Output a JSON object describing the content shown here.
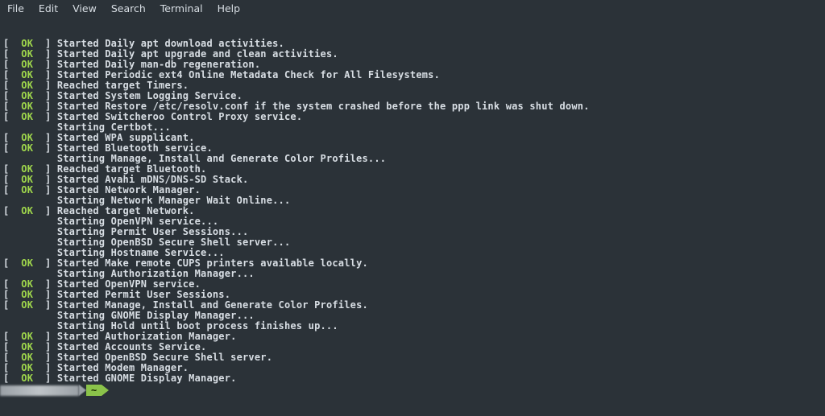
{
  "menu": [
    "File",
    "Edit",
    "View",
    "Search",
    "Terminal",
    "Help"
  ],
  "ok": "OK",
  "lines": [
    {
      "s": "ok",
      "t": "Started Daily apt download activities."
    },
    {
      "s": "ok",
      "t": "Started Daily apt upgrade and clean activities."
    },
    {
      "s": "ok",
      "t": "Started Daily man-db regeneration."
    },
    {
      "s": "ok",
      "t": "Started Periodic ext4 Online Metadata Check for All Filesystems."
    },
    {
      "s": "ok",
      "t": "Reached target Timers."
    },
    {
      "s": "ok",
      "t": "Started System Logging Service."
    },
    {
      "s": "ok",
      "t": "Started Restore /etc/resolv.conf if the system crashed before the ppp link was shut down."
    },
    {
      "s": "ok",
      "t": "Started Switcheroo Control Proxy service."
    },
    {
      "s": "",
      "t": "Starting Certbot..."
    },
    {
      "s": "ok",
      "t": "Started WPA supplicant."
    },
    {
      "s": "ok",
      "t": "Started Bluetooth service."
    },
    {
      "s": "",
      "t": "Starting Manage, Install and Generate Color Profiles..."
    },
    {
      "s": "ok",
      "t": "Reached target Bluetooth."
    },
    {
      "s": "ok",
      "t": "Started Avahi mDNS/DNS-SD Stack."
    },
    {
      "s": "ok",
      "t": "Started Network Manager."
    },
    {
      "s": "",
      "t": "Starting Network Manager Wait Online..."
    },
    {
      "s": "ok",
      "t": "Reached target Network."
    },
    {
      "s": "",
      "t": "Starting OpenVPN service..."
    },
    {
      "s": "",
      "t": "Starting Permit User Sessions..."
    },
    {
      "s": "",
      "t": "Starting OpenBSD Secure Shell server..."
    },
    {
      "s": "",
      "t": "Starting Hostname Service..."
    },
    {
      "s": "ok",
      "t": "Started Make remote CUPS printers available locally."
    },
    {
      "s": "",
      "t": "Starting Authorization Manager..."
    },
    {
      "s": "ok",
      "t": "Started OpenVPN service."
    },
    {
      "s": "ok",
      "t": "Started Permit User Sessions."
    },
    {
      "s": "ok",
      "t": "Started Manage, Install and Generate Color Profiles."
    },
    {
      "s": "",
      "t": "Starting GNOME Display Manager..."
    },
    {
      "s": "",
      "t": "Starting Hold until boot process finishes up..."
    },
    {
      "s": "ok",
      "t": "Started Authorization Manager."
    },
    {
      "s": "ok",
      "t": "Started Accounts Service."
    },
    {
      "s": "ok",
      "t": "Started OpenBSD Secure Shell server."
    },
    {
      "s": "ok",
      "t": "Started Modem Manager."
    },
    {
      "s": "ok",
      "t": "Started GNOME Display Manager."
    }
  ],
  "prompt": {
    "path": "~"
  }
}
